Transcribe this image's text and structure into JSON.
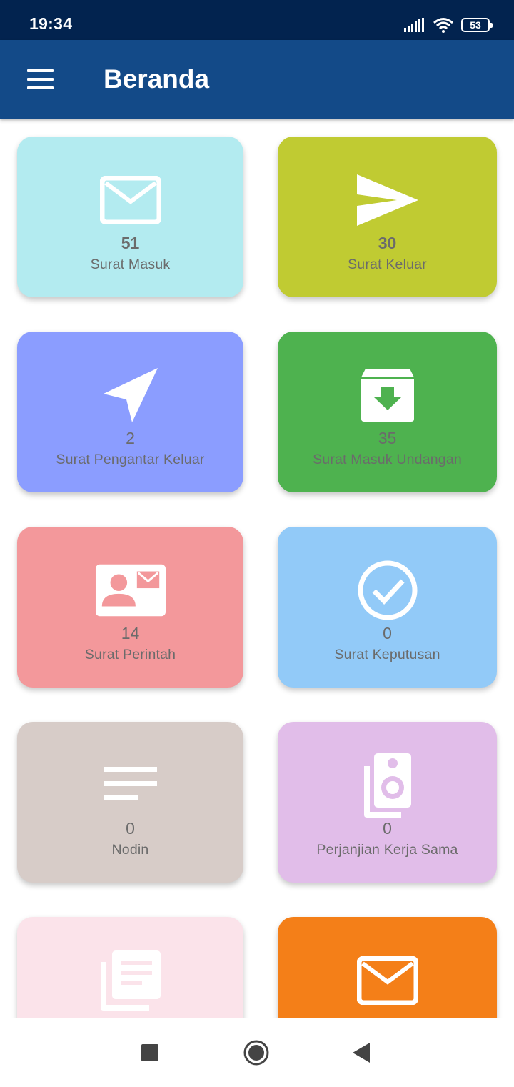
{
  "status_bar": {
    "time": "19:34",
    "battery": "53"
  },
  "app_bar": {
    "title": "Beranda",
    "menu_icon": "hamburger-menu-icon"
  },
  "cards": [
    {
      "count": "51",
      "label": "Surat Masuk",
      "icon": "envelope-icon",
      "color": "#b3ebf0"
    },
    {
      "count": "30",
      "label": "Surat Keluar",
      "icon": "send-icon",
      "color": "#c0cb32"
    },
    {
      "count": "2",
      "label": "Surat Pengantar Keluar",
      "icon": "navigation-arrow-icon",
      "color": "#8b9dff"
    },
    {
      "count": "35",
      "label": "Surat Masuk Undangan",
      "icon": "archive-download-icon",
      "color": "#4eb24f"
    },
    {
      "count": "14",
      "label": "Surat Perintah",
      "icon": "contact-mail-icon",
      "color": "#f3989b"
    },
    {
      "count": "0",
      "label": "Surat Keputusan",
      "icon": "check-circle-icon",
      "color": "#92caf8"
    },
    {
      "count": "0",
      "label": "Nodin",
      "icon": "notes-lines-icon",
      "color": "#d7ccc8"
    },
    {
      "count": "0",
      "label": "Perjanjian Kerja Sama",
      "icon": "speaker-library-icon",
      "color": "#e1bde9"
    },
    {
      "icon": "document-library-icon",
      "color": "#fbe3ea"
    },
    {
      "icon": "envelope-icon",
      "color": "#f47f18"
    }
  ],
  "nav_bar": {
    "recent_icon": "square-recents-icon",
    "home_icon": "circle-home-icon",
    "back_icon": "triangle-back-icon"
  }
}
